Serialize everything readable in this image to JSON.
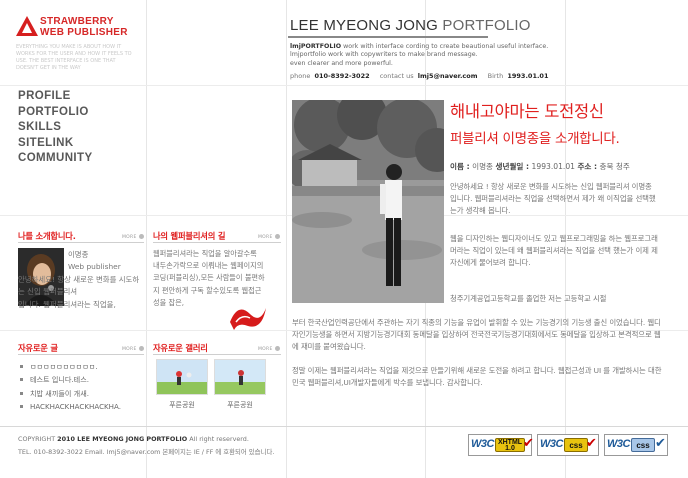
{
  "logo": {
    "line1": "STRAWBERRY",
    "line2": "WEB PUBLISHER",
    "tagline": "EVERYTHING YOU MAKE IS ABOUT HOW IT WORKS FOR THE USER AND HOW IT FEELS TO USE. THE BEST INTERFACE IS ONE THAT DOESN'T GET IN THE WAY"
  },
  "nav": {
    "items": [
      "PROFILE",
      "PORTFOLIO",
      "SKILLS",
      "SITELINK",
      "COMMUNITY"
    ]
  },
  "header": {
    "title_main": "LEE MYEONG JONG",
    "title_accent": "PORTFOLIO",
    "desc_brand": "lmjPORTFOLIO",
    "desc_line1": "work with interface cording to create beautional useful interface.",
    "desc_line2": "lmjportfolio work with copywriters to make brand message.",
    "desc_line3": "even clearer and more powerful.",
    "contact": {
      "phone_label": "phone",
      "phone_value": "010-8392-3022",
      "contact_label": "contact us",
      "contact_value": "lmj5@naver.com",
      "birth_label": "Birth",
      "birth_value": "1993.01.01"
    }
  },
  "main": {
    "headline": "해내고야마는 도전정신",
    "subheadline": "퍼블리셔 이명종을 소개합니다.",
    "info": {
      "name_label": "이름 :",
      "name_value": "이명종",
      "birth_label": "생년월일 :",
      "birth_value": "1993.01.01",
      "address_label": "주소 :",
      "address_value": "충북 청주"
    },
    "para1": "안녕하세요 ! 항상 새로운 변화를 시도하는 신입 웹퍼블리셔 이명종 입니다. 웹퍼블리셔라는 직업을 선택하면서 제가 왜 이직업을 선택했는가 생각해 봅니다.",
    "para2": "웹을 디자인하는 웹디자이너도 있고 웹프로그래밍을 하는 웹프로그래머라는 직업이 있는데 왜 웹퍼블리셔라는 직업을 선택 했는가 이제 제 자신에게 물어보려 합니다.",
    "para3a": "청주기계공업고등학교를 졸업한 저는 고등학교 시절",
    "para3b": "부터 한국산업인력공단에서 주관하는 자기 직종의 기능을 유업이 발휘할 수 있는 기능경기의 기능생 출신 이었습니다. 웹디자인기능생을 하면서 지방기능경기대회 동메달을 입상하여 전국전국기능경기대회에서도 동메달을 입상하고 본격적으로 웹에 재미를 붙여왔습니다.",
    "para4": "정말 이제는 웹퍼블리셔라는 직업을 제것으로 만들기위해 새로운 도전을 하려고 합니다. 웹접근성과 UI 를 개발하시는 대한민국 웹퍼블리셔,UI개발자들에게 박수를 보냅니다. 감사합니다."
  },
  "sections": {
    "intro": {
      "title": "나를 소개합니다.",
      "more": "MORE",
      "name": "이명종",
      "text": [
        "Web publisher",
        "안녕하세요! 항상 새로운 변화를 시도하는 신입 웹퍼블리셔",
        "입니다. 웹퍼블리셔라는 직업을,"
      ]
    },
    "blog": {
      "title": "나의 웹퍼블리셔의 길",
      "more": "MORE",
      "text": "웹퍼블리셔라는 직업을 알아갈수록 내두손가락으로 이뤄내는 웹페이지의 코딩(퍼블리싱),모든 사람들이 불편하지 편안하게 구독 할수있도록 웹접근성을 잡은,"
    },
    "free": {
      "title": "자유로운 글",
      "more": "MORE",
      "items": [
        "ㅁㅁㅁㅁㅁㅁㅁㅁㅁㅁ.",
        "테스트 입니다.테스.",
        "치밥 새끼들이 개새.",
        "HACKHACKHACKHACKHA."
      ]
    },
    "gallery": {
      "title": "자유로운 갤러리",
      "more": "MORE",
      "items": [
        {
          "caption": "푸른공원"
        },
        {
          "caption": "푸른공원"
        }
      ]
    }
  },
  "footer": {
    "copyright_prefix": "COPYRIGHT",
    "copyright_bold": "2010 LEE MYEONG JONG PORTFOLIO",
    "copyright_suffix": "All right reserverd.",
    "line2": "TEL. 010-8392-3022 Email. lmj5@naver.com 본페이지는 IE / FF 에 호환되어 있습니다."
  },
  "badges": {
    "xhtml": {
      "w3c": "W3C",
      "line1": "XHTML",
      "line2": "1.0"
    },
    "css_yellow": {
      "w3c": "W3C",
      "label": "css"
    },
    "css_blue": {
      "w3c": "W3C",
      "label": "css"
    }
  },
  "colors": {
    "accent_red": "#e0201f",
    "text_gray": "#777777",
    "badge_yellow": "#e8c30f",
    "badge_blue": "#a8c6e8"
  }
}
